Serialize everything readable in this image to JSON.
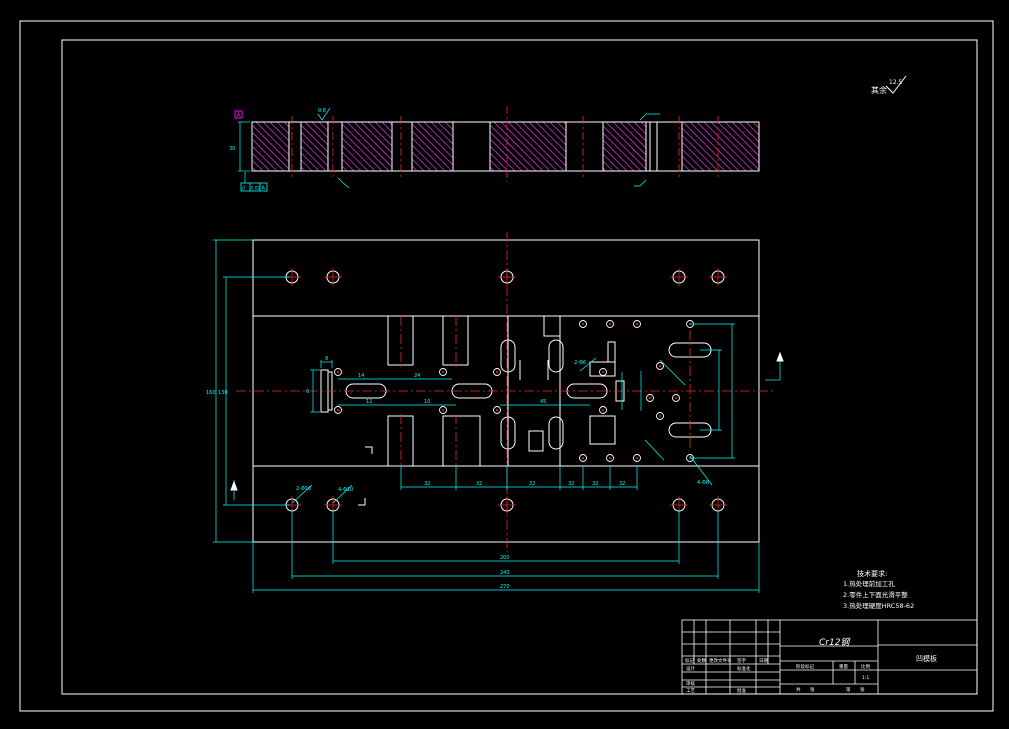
{
  "colors": {
    "background": "#000000",
    "frame": "#ffffff",
    "outline": "#ffffff",
    "dimension": "#00ffff",
    "center_line": "#ff2020",
    "hatch": "#cc33cc",
    "text_block": "#ffffff",
    "roughness": "#ffffff",
    "datum": "#ff00ff"
  },
  "section_view": {
    "datum_label": "A",
    "flatness_symbol": "//",
    "flatness_value": "0.02",
    "flatness_datum": "A",
    "roughness_value": "0.8",
    "thickness_dim": "30"
  },
  "corner_roughness": {
    "prefix": "其余",
    "value": "12.5"
  },
  "plan_view": {
    "overall_width_dim": "270",
    "hole_span_outer_dim": "240",
    "hole_span_inner_dim": "200",
    "overall_height_dim": "160",
    "inner_height_dim": "130",
    "hole_note_1": "2-Φ10",
    "hole_note_2": "4-Φ10",
    "hole_note_3": "2-Φ6",
    "hole_note_4": "4-Φ8",
    "small_dims": [
      "32",
      "32",
      "32",
      "32",
      "32",
      "32",
      "45",
      "24",
      "14",
      "12",
      "10",
      "8",
      "6"
    ]
  },
  "tech_requirements": {
    "title": "技术要求:",
    "items": [
      "1.热处理前加工孔",
      "2.零件上下面光滑平整",
      "3.热处理硬度HRC58-62"
    ]
  },
  "title_block": {
    "material": "Cr12钢",
    "part_name": "凹模板",
    "row_labels": [
      "标记",
      "处数",
      "更改文件号",
      "签字",
      "日期"
    ],
    "left_labels": [
      "设计",
      "标准化",
      "审核",
      "工艺",
      "批准"
    ],
    "stage_labels": [
      "阶段标记",
      "重量",
      "比例"
    ],
    "sheet_labels": [
      "共",
      "张",
      "第",
      "张"
    ],
    "scale": "1:1"
  }
}
